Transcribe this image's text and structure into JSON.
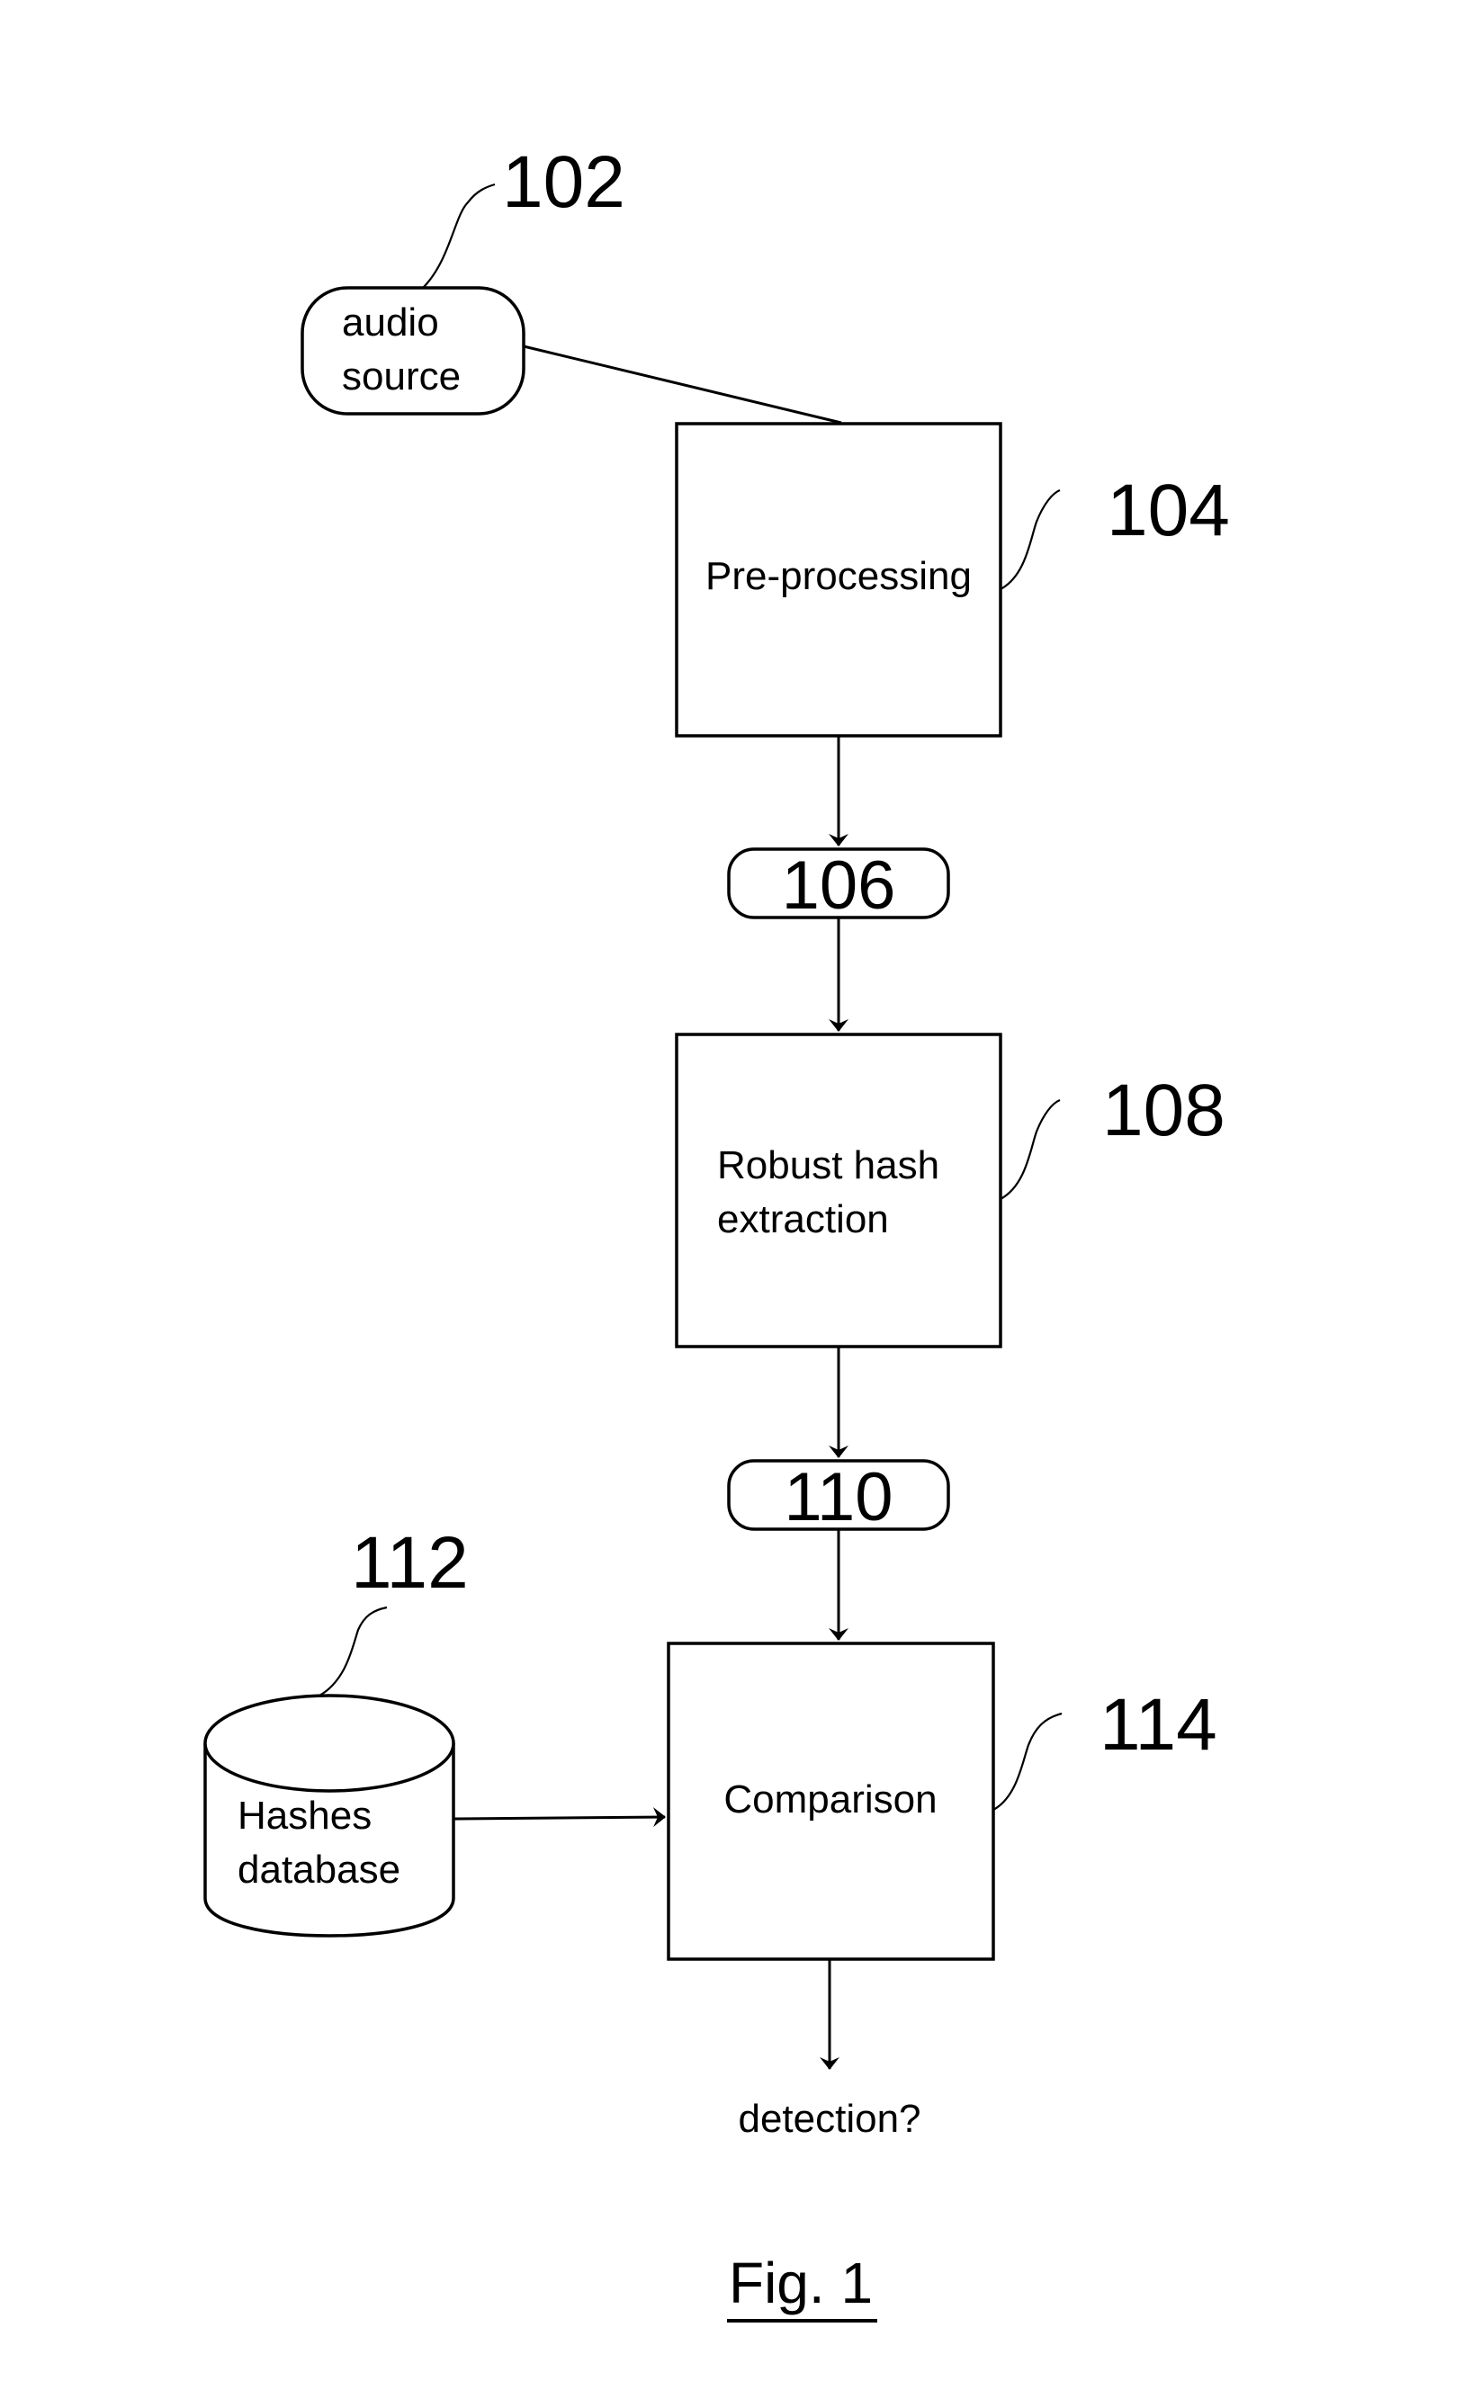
{
  "figure": {
    "caption": "Fig. 1"
  },
  "nodes": {
    "audio_source": {
      "ref": "102",
      "lines": [
        "audio",
        "source"
      ]
    },
    "preprocessing": {
      "ref": "104",
      "label": "Pre-processing"
    },
    "signal_106": {
      "ref": "106"
    },
    "hash_extraction": {
      "ref": "108",
      "lines": [
        "Robust hash",
        "extraction"
      ]
    },
    "signal_110": {
      "ref": "110"
    },
    "hashes_database": {
      "ref": "112",
      "lines": [
        "Hashes",
        "database"
      ]
    },
    "comparison": {
      "ref": "114",
      "label": "Comparison"
    },
    "output": {
      "label": "detection?"
    }
  }
}
